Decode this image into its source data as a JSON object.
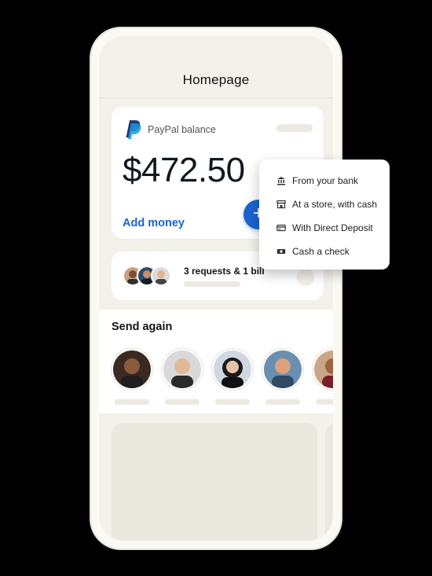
{
  "header": {
    "title": "Homepage"
  },
  "balance": {
    "label": "PayPal balance",
    "amount": "$472.50",
    "add_money": "Add money"
  },
  "requests": {
    "text": "3 requests & 1 bill"
  },
  "send_again": {
    "title": "Send again",
    "contacts": [
      {
        "avatar": "person-1"
      },
      {
        "avatar": "person-2"
      },
      {
        "avatar": "person-3"
      },
      {
        "avatar": "person-4"
      },
      {
        "avatar": "person-5"
      }
    ]
  },
  "add_money_menu": {
    "items": [
      {
        "label": "From your bank",
        "icon": "bank-icon"
      },
      {
        "label": "At a store, with cash",
        "icon": "store-icon"
      },
      {
        "label": "With Direct Deposit",
        "icon": "direct-deposit-icon"
      },
      {
        "label": "Cash a check",
        "icon": "check-icon"
      }
    ]
  },
  "colors": {
    "accent": "#1b63d0",
    "background": "#000000",
    "phone": "#fbf9f4"
  }
}
